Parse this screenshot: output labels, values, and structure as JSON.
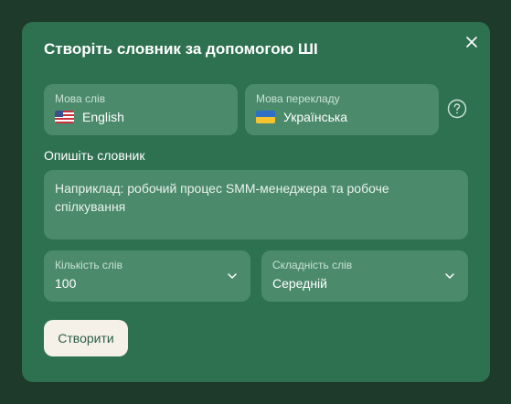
{
  "modal": {
    "title": "Створіть словник за допомогою ШІ",
    "close_icon": "close-icon"
  },
  "source_language": {
    "label": "Мова слів",
    "value": "English",
    "flag": "us-flag-icon"
  },
  "target_language": {
    "label": "Мова перекладу",
    "value": "Українська",
    "flag": "ua-flag-icon"
  },
  "help_icon": "help-circle-icon",
  "description": {
    "label": "Опишіть словник",
    "placeholder": "Наприклад: робочий процес SMM-менеджера та робоче спілкування"
  },
  "word_count": {
    "label": "Кількість слів",
    "value": "100"
  },
  "difficulty": {
    "label": "Складність слів",
    "value": "Середній"
  },
  "create_button": {
    "label": "Створити"
  },
  "colors": {
    "backdrop": "#1e3a2b",
    "modal": "#2e7151",
    "field": "#4b8b6b",
    "button": "#f5f1e9"
  }
}
